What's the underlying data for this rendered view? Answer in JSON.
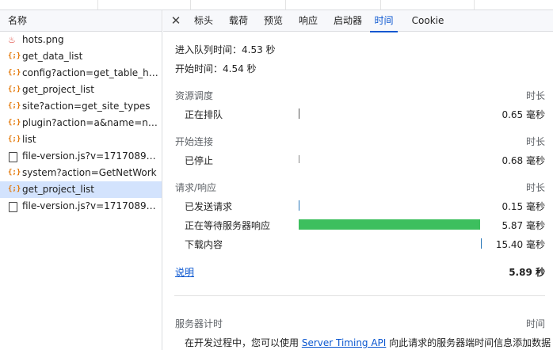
{
  "left_panel": {
    "header": "名称",
    "requests": [
      {
        "name": "hots.png",
        "icon": "image-icon",
        "selected": false
      },
      {
        "name": "get_data_list",
        "icon": "json-icon",
        "selected": false
      },
      {
        "name": "config?action=get_table_hea…",
        "icon": "json-icon",
        "selected": false
      },
      {
        "name": "get_project_list",
        "icon": "json-icon",
        "selected": false
      },
      {
        "name": "site?action=get_site_types",
        "icon": "json-icon",
        "selected": false
      },
      {
        "name": "plugin?action=a&name=nod…",
        "icon": "json-icon",
        "selected": false
      },
      {
        "name": "list",
        "icon": "json-icon",
        "selected": false
      },
      {
        "name": "file-version.js?v=171708901…",
        "icon": "document-icon",
        "selected": false
      },
      {
        "name": "system?action=GetNetWork",
        "icon": "json-icon",
        "selected": false
      },
      {
        "name": "get_project_list",
        "icon": "json-icon",
        "selected": true
      },
      {
        "name": "file-version.js?v=171708901…",
        "icon": "document-icon",
        "selected": false
      }
    ]
  },
  "tabs": {
    "close_label": "✕",
    "items": [
      {
        "label": "标头",
        "active": false
      },
      {
        "label": "载荷",
        "active": false
      },
      {
        "label": "预览",
        "active": false
      },
      {
        "label": "响应",
        "active": false
      },
      {
        "label": "启动器",
        "active": false
      },
      {
        "label": "时间",
        "active": true
      },
      {
        "label": "Cookie",
        "active": false
      }
    ]
  },
  "timing": {
    "queued_at": "进入队列时间：4.53 秒",
    "started_at": "开始时间：4.54 秒",
    "duration_header": "时长",
    "sections": [
      {
        "title": "资源调度",
        "rows": [
          {
            "label": "正在排队",
            "value": "0.65 毫秒",
            "start_ms": 0,
            "duration_ms": 0.65
          }
        ]
      },
      {
        "title": "开始连接",
        "rows": [
          {
            "label": "已停止",
            "value": "0.68 毫秒",
            "start_ms": 0,
            "duration_ms": 0.68
          }
        ]
      },
      {
        "title": "请求/响应",
        "rows": [
          {
            "label": "已发送请求",
            "value": "0.15 毫秒",
            "start_ms": 0,
            "duration_ms": 0.15
          },
          {
            "label": "正在等待服务器响应",
            "value": "5.87 毫秒",
            "start_ms": 0.15,
            "duration_ms": 5.87
          },
          {
            "label": "下载内容",
            "value": "15.40 毫秒",
            "start_ms": 6.02,
            "duration_ms": 0.05
          }
        ]
      }
    ],
    "explanation_link": "说明",
    "total": "5.89 秒",
    "server_timing": {
      "title": "服务器计时",
      "duration_header": "时间",
      "text_before": "在开发过程中，您可以使用 ",
      "link": "Server Timing API",
      "text_after": " 向此请求的服务器端时间信息添加数据"
    },
    "colors": {
      "waiting_bar": "#3dbf5e",
      "tick": "#555555",
      "download_tick": "#2a78b9"
    }
  }
}
